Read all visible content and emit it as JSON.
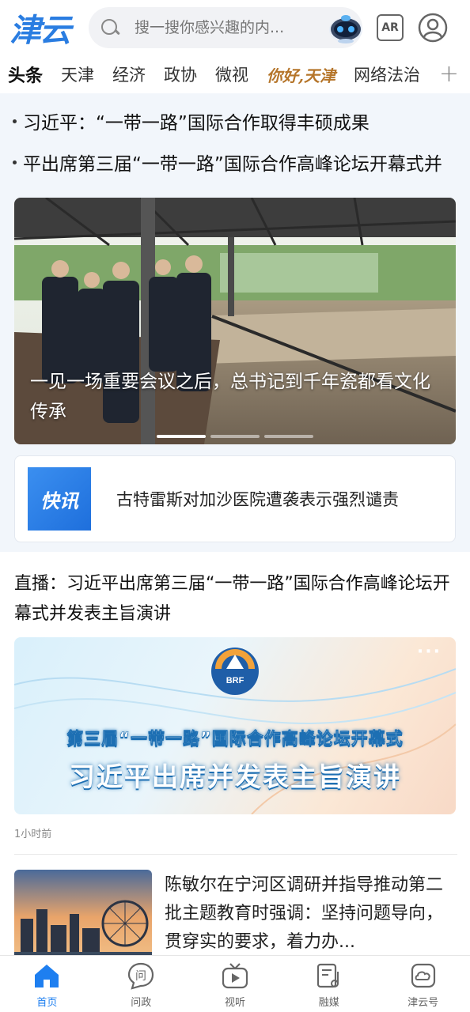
{
  "header": {
    "logo_text": "津云",
    "search_placeholder": "搜一搜你感兴趣的内...",
    "ar_label": "AR"
  },
  "tabs": [
    {
      "label": "头条",
      "active": true
    },
    {
      "label": "天津"
    },
    {
      "label": "经济"
    },
    {
      "label": "政协"
    },
    {
      "label": "微视"
    },
    {
      "label": "你好,天津",
      "brand": true
    },
    {
      "label": "网络法治"
    }
  ],
  "headlines": [
    "习近平：“一带一路”国际合作取得丰硕成果",
    "平出席第三届“一带一路”国际合作高峰论坛开幕式并"
  ],
  "carousel": {
    "caption": "一见一场重要会议之后，总书记到千年瓷都看文化传承",
    "slide_count": 3,
    "active_slide": 1
  },
  "flash": {
    "badge": "快讯",
    "text": "古特雷斯对加沙医院遭袭表示强烈谴责"
  },
  "live": {
    "title": "直播：习近平出席第三届“一带一路”国际合作高峰论坛开幕式并发表主旨演讲",
    "banner_line1": "第三届“一带一路”国际合作高峰论坛开幕式",
    "banner_line2": "习近平出席并发表主旨演讲",
    "banner_logo_text": "BRF",
    "more": "···",
    "timestamp": "1小时前"
  },
  "news": {
    "text": "陈敏尔在宁河区调研并指导推动第二批主题教育时强调：坚持问题导向，贯穿实的要求，着力办..."
  },
  "bottom_nav": [
    {
      "label": "首页",
      "icon": "home-icon",
      "active": true
    },
    {
      "label": "问政",
      "icon": "question-icon"
    },
    {
      "label": "视听",
      "icon": "tv-icon"
    },
    {
      "label": "融媒",
      "icon": "music-icon"
    },
    {
      "label": "津云号",
      "icon": "cloud-icon"
    }
  ],
  "colors": {
    "accent": "#1e7ff0",
    "section_bg": "#f2f6fb"
  }
}
